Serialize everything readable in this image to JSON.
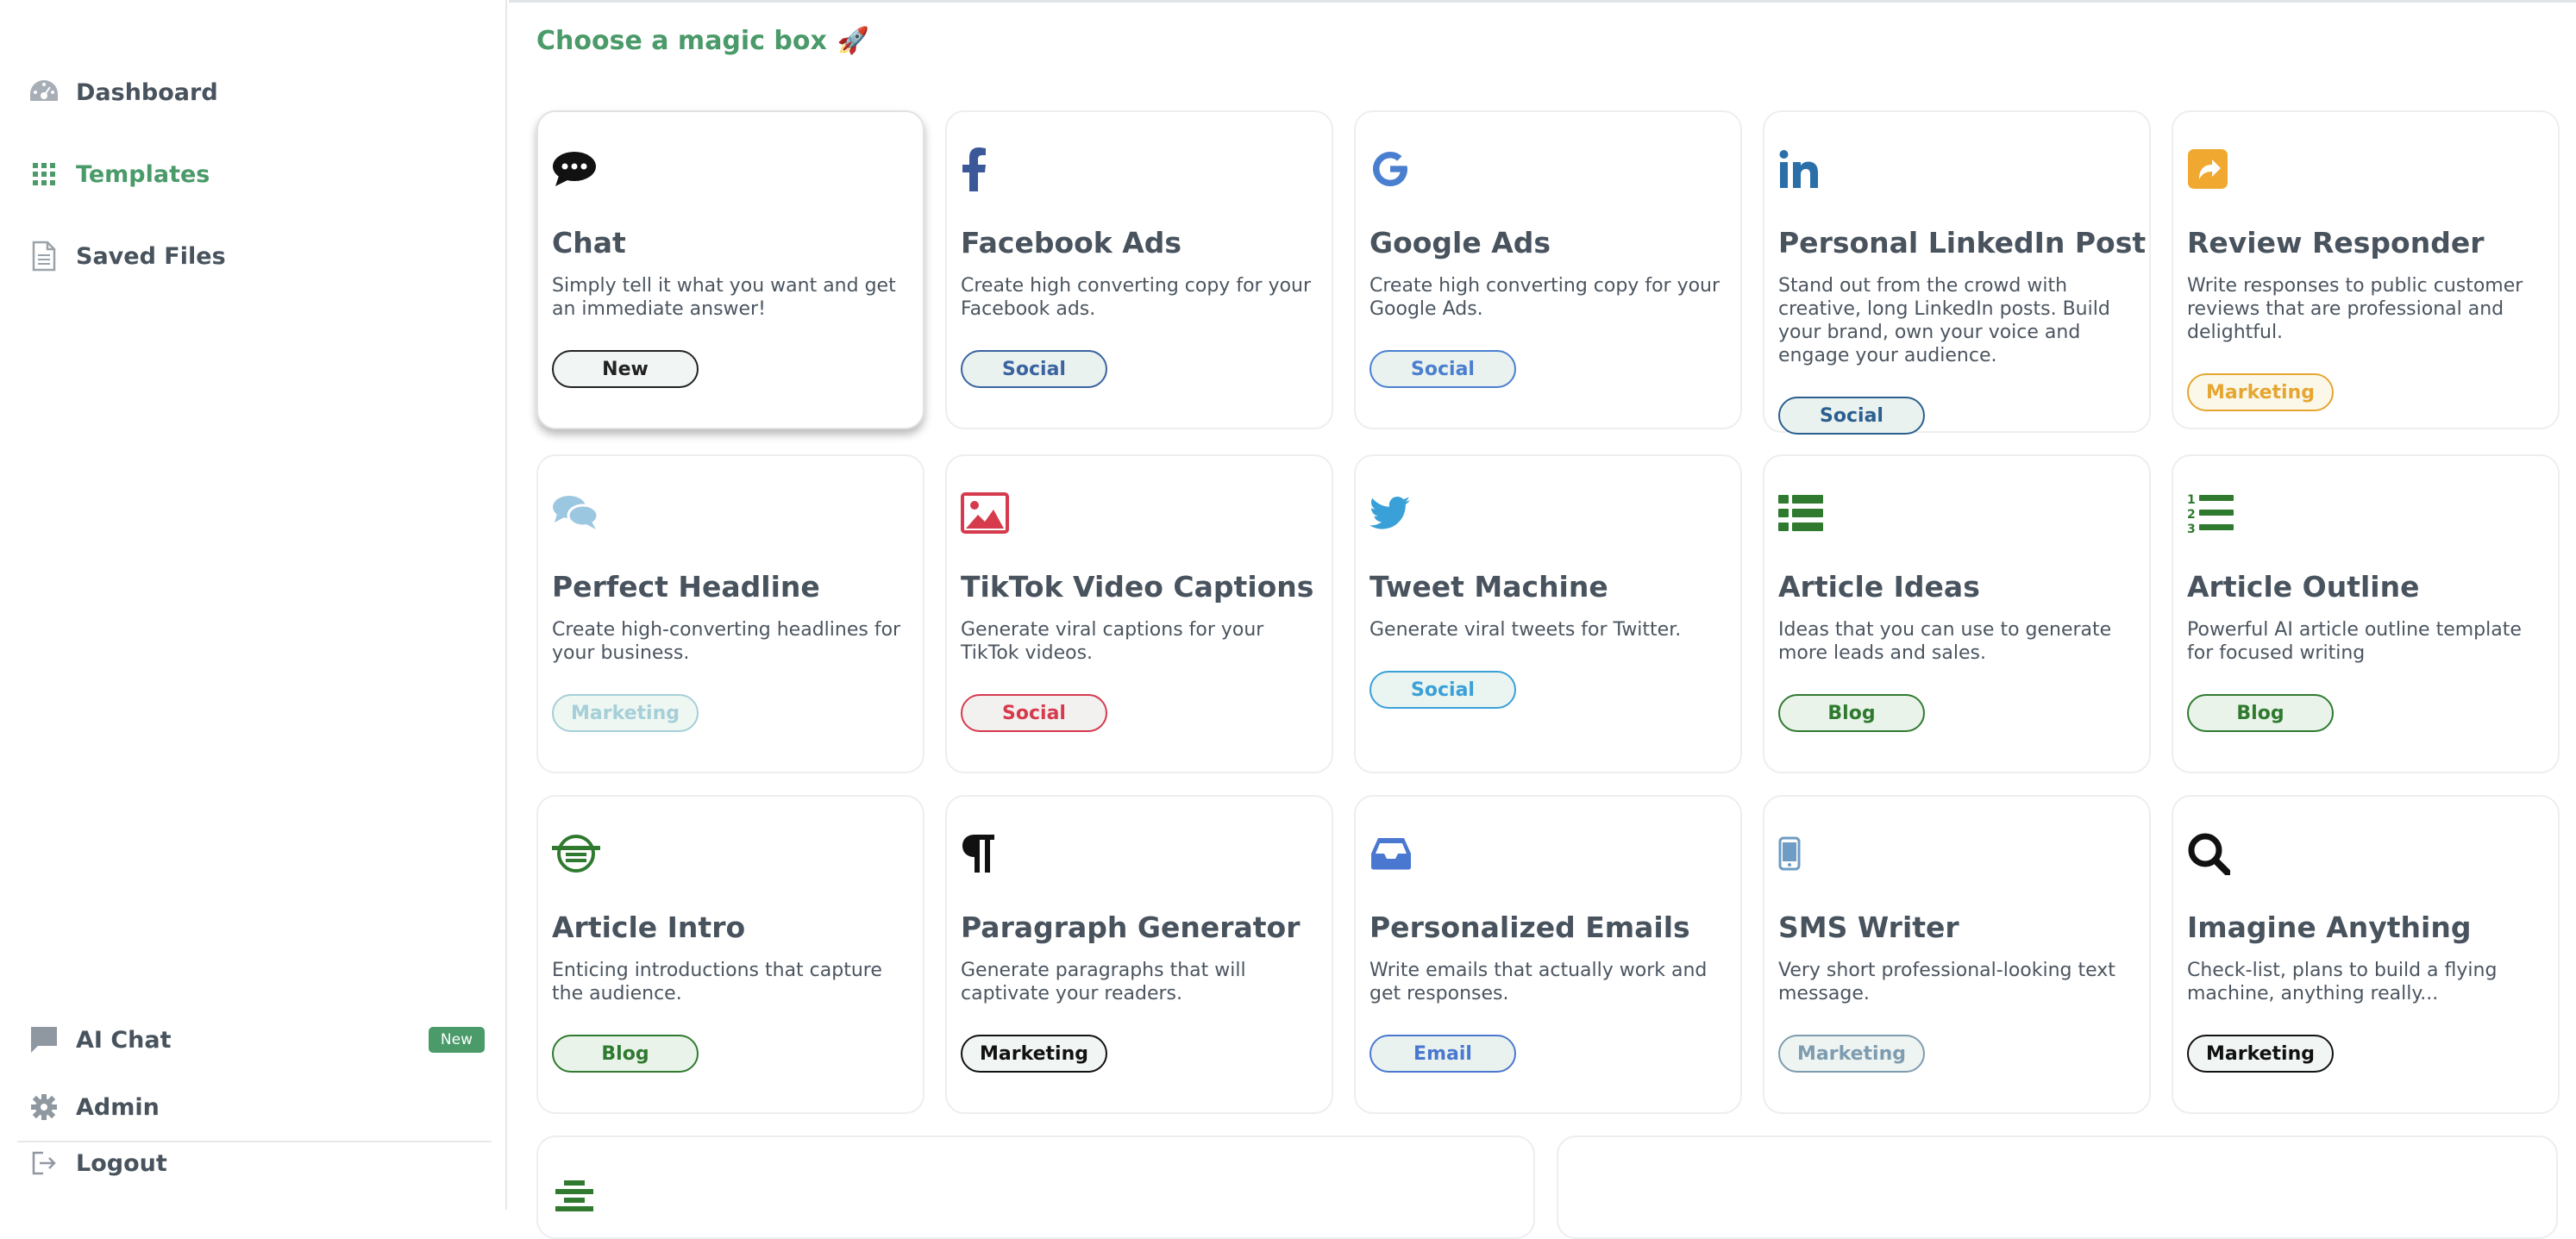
{
  "sidebar": {
    "dashboard": "Dashboard",
    "templates": "Templates",
    "saved_files": "Saved Files",
    "ai_chat": "AI Chat",
    "ai_chat_badge": "New",
    "admin": "Admin",
    "logout": "Logout"
  },
  "main": {
    "heading": "Choose a magic box",
    "heading_emoji": "🚀"
  },
  "cards": [
    {
      "title": "Chat",
      "desc": "Simply tell it what you want and get an immediate answer!",
      "tag": "New",
      "icon": "chat-icon"
    },
    {
      "title": "Facebook Ads",
      "desc": "Create high converting copy for your Facebook ads.",
      "tag": "Social",
      "icon": "facebook-icon"
    },
    {
      "title": "Google Ads",
      "desc": "Create high converting copy for your Google Ads.",
      "tag": "Social",
      "icon": "google-icon"
    },
    {
      "title": "Personal LinkedIn Post",
      "desc": "Stand out from the crowd with creative, long LinkedIn posts. Build your brand, own your voice and engage your audience.",
      "tag": "Social",
      "icon": "linkedin-icon"
    },
    {
      "title": "Review Responder",
      "desc": "Write responses to public customer reviews that are professional and delightful.",
      "tag": "Marketing",
      "icon": "share-arrow-icon"
    },
    {
      "title": "Perfect Headline",
      "desc": "Create high-converting headlines for your business.",
      "tag": "Marketing",
      "icon": "comments-icon"
    },
    {
      "title": "TikTok Video Captions",
      "desc": "Generate viral captions for your TikTok videos.",
      "tag": "Social",
      "icon": "image-icon"
    },
    {
      "title": "Tweet Machine",
      "desc": "Generate viral tweets for Twitter.",
      "tag": "Social",
      "icon": "twitter-icon"
    },
    {
      "title": "Article Ideas",
      "desc": "Ideas that you can use to generate more leads and sales.",
      "tag": "Blog",
      "icon": "list-icon"
    },
    {
      "title": "Article Outline",
      "desc": "Powerful AI article outline template for focused writing",
      "tag": "Blog",
      "icon": "numbered-list-icon"
    },
    {
      "title": "Article Intro",
      "desc": "Enticing introductions that capture the audience.",
      "tag": "Blog",
      "icon": "circle-text-icon"
    },
    {
      "title": "Paragraph Generator",
      "desc": "Generate paragraphs that will captivate your readers.",
      "tag": "Marketing",
      "icon": "paragraph-icon"
    },
    {
      "title": "Personalized Emails",
      "desc": "Write emails that actually work and get responses.",
      "tag": "Email",
      "icon": "inbox-icon"
    },
    {
      "title": "SMS Writer",
      "desc": "Very short professional-looking text message.",
      "tag": "Marketing",
      "icon": "mobile-icon"
    },
    {
      "title": "Imagine Anything",
      "desc": "Check-list, plans to build a flying machine, anything really...",
      "tag": "Marketing",
      "icon": "search-icon"
    }
  ],
  "colors": {
    "accent": "#4a9a6a",
    "text": "#48535e"
  }
}
